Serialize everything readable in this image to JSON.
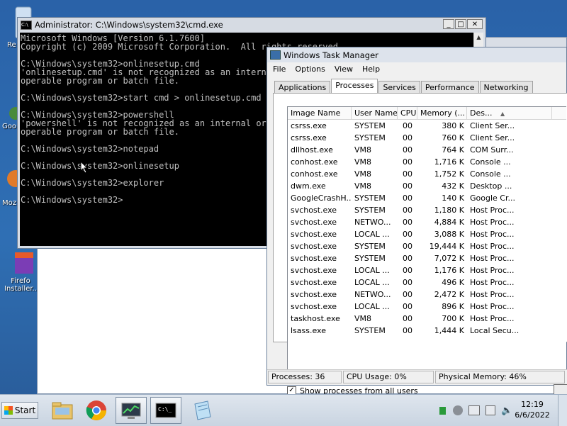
{
  "desktop": {
    "icons": [
      {
        "label": "Re"
      },
      {
        "label": "Goo"
      },
      {
        "label": "Moz"
      },
      {
        "label": "Firefo"
      },
      {
        "label": "Installer.."
      }
    ]
  },
  "cmd": {
    "title": "Administrator: C:\\Windows\\system32\\cmd.exe",
    "lines": [
      "Microsoft Windows [Version 6.1.7600]",
      "Copyright (c) 2009 Microsoft Corporation.  All rights reserved.",
      "",
      "C:\\Windows\\system32>onlinesetup.cmd",
      "'onlinesetup.cmd' is not recognized as an internal or external command,",
      "operable program or batch file.",
      "",
      "C:\\Windows\\system32>start cmd > onlinesetup.cmd",
      "",
      "C:\\Windows\\system32>powershell",
      "'powershell' is not recognized as an internal or external command,",
      "operable program or batch file.",
      "",
      "C:\\Windows\\system32>notepad",
      "",
      "C:\\Windows\\system32>onlinesetup",
      "",
      "C:\\Windows\\system32>explorer",
      "",
      "C:\\Windows\\system32>"
    ]
  },
  "taskmgr": {
    "title": "Windows Task Manager",
    "menu": [
      "File",
      "Options",
      "View",
      "Help"
    ],
    "tabs": [
      "Applications",
      "Processes",
      "Services",
      "Performance",
      "Networking"
    ],
    "active_tab": "Processes",
    "columns": [
      "Image Name",
      "User Name",
      "CPU",
      "Memory (...",
      "Des..."
    ],
    "rows": [
      [
        "csrss.exe",
        "SYSTEM",
        "00",
        "380 K",
        "Client Ser..."
      ],
      [
        "csrss.exe",
        "SYSTEM",
        "00",
        "760 K",
        "Client Ser..."
      ],
      [
        "dllhost.exe",
        "VM8",
        "00",
        "764 K",
        "COM Surr..."
      ],
      [
        "conhost.exe",
        "VM8",
        "00",
        "1,716 K",
        "Console ..."
      ],
      [
        "conhost.exe",
        "VM8",
        "00",
        "1,752 K",
        "Console ..."
      ],
      [
        "dwm.exe",
        "VM8",
        "00",
        "432 K",
        "Desktop ..."
      ],
      [
        "GoogleCrashH...",
        "SYSTEM",
        "00",
        "140 K",
        "Google Cr..."
      ],
      [
        "svchost.exe",
        "SYSTEM",
        "00",
        "1,180 K",
        "Host Proc..."
      ],
      [
        "svchost.exe",
        "NETWO...",
        "00",
        "4,884 K",
        "Host Proc..."
      ],
      [
        "svchost.exe",
        "LOCAL ...",
        "00",
        "3,088 K",
        "Host Proc..."
      ],
      [
        "svchost.exe",
        "SYSTEM",
        "00",
        "19,444 K",
        "Host Proc..."
      ],
      [
        "svchost.exe",
        "SYSTEM",
        "00",
        "7,072 K",
        "Host Proc..."
      ],
      [
        "svchost.exe",
        "LOCAL ...",
        "00",
        "1,176 K",
        "Host Proc..."
      ],
      [
        "svchost.exe",
        "LOCAL ...",
        "00",
        "496 K",
        "Host Proc..."
      ],
      [
        "svchost.exe",
        "NETWO...",
        "00",
        "2,472 K",
        "Host Proc..."
      ],
      [
        "svchost.exe",
        "LOCAL ...",
        "00",
        "896 K",
        "Host Proc..."
      ],
      [
        "taskhost.exe",
        "VM8",
        "00",
        "700 K",
        "Host Proc..."
      ],
      [
        "lsass.exe",
        "SYSTEM",
        "00",
        "1,444 K",
        "Local Secu..."
      ]
    ],
    "show_all_label": "Show processes from all users",
    "show_all_checked": "✓",
    "status": {
      "processes": "Processes: 36",
      "cpu": "CPU Usage: 0%",
      "memory": "Physical Memory: 46%"
    }
  },
  "taskbar": {
    "start_label": "Start",
    "time": "12:19",
    "date": "6/6/2022"
  }
}
